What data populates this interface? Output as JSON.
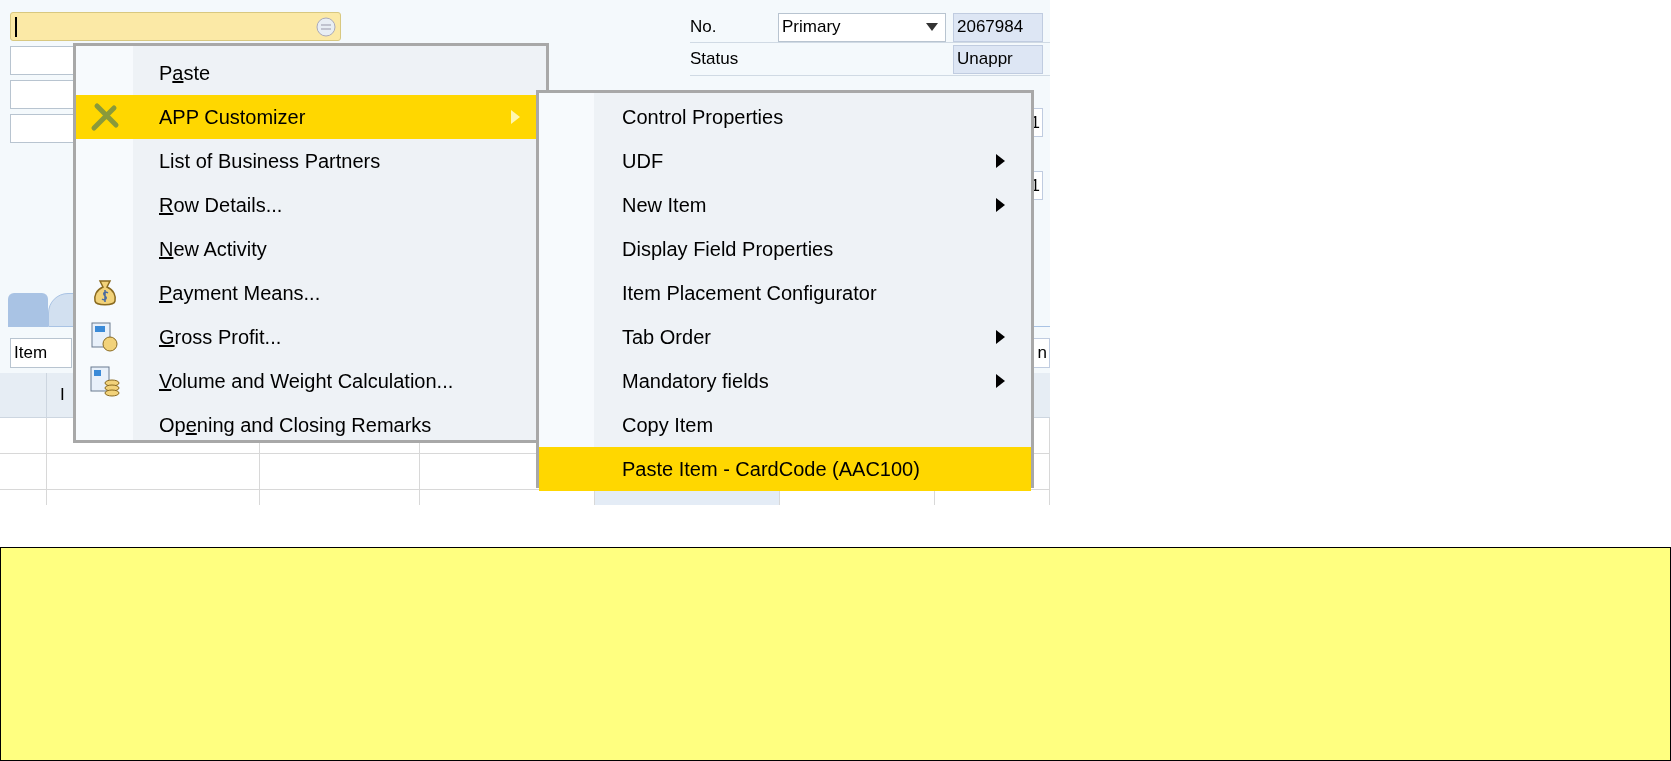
{
  "form": {
    "number_label": "No.",
    "series_dropdown": "Primary",
    "number": "2067984",
    "status_label": "Status",
    "status": "Unappr",
    "partial_values": [
      "1",
      "1"
    ],
    "partial_field": "n"
  },
  "matrix": {
    "type_dropdown": "Item",
    "column_1": "I"
  },
  "context_menu": {
    "items": [
      {
        "text": [
          {
            "part": "P",
            "underlined": false
          },
          {
            "part": "a",
            "underlined": true
          },
          {
            "part": "ste",
            "underlined": false
          }
        ],
        "selected": false,
        "submenu": false
      },
      {
        "text": [
          {
            "part": "APP Customizer",
            "underlined": false
          }
        ],
        "selected": true,
        "submenu": true
      },
      {
        "text": [
          {
            "part": "List of Business Partners",
            "underlined": false
          }
        ],
        "selected": false,
        "submenu": false
      },
      {
        "text": [
          {
            "part": "R",
            "underlined": true
          },
          {
            "part": "ow Details...",
            "underlined": false
          }
        ],
        "selected": false,
        "submenu": false
      },
      {
        "text": [
          {
            "part": "N",
            "underlined": true
          },
          {
            "part": "ew Activity",
            "underlined": false
          }
        ],
        "selected": false,
        "submenu": false
      },
      {
        "text": [
          {
            "part": "P",
            "underlined": true
          },
          {
            "part": "ayment Means...",
            "underlined": false
          }
        ],
        "selected": false,
        "submenu": false
      },
      {
        "text": [
          {
            "part": "G",
            "underlined": true
          },
          {
            "part": "ross Profit...",
            "underlined": false
          }
        ],
        "selected": false,
        "submenu": false
      },
      {
        "text": [
          {
            "part": "V",
            "underlined": true
          },
          {
            "part": "olume and Weight Calculation...",
            "underlined": false
          }
        ],
        "selected": false,
        "submenu": false
      },
      {
        "text": [
          {
            "part": "Op",
            "underlined": false
          },
          {
            "part": "e",
            "underlined": true
          },
          {
            "part": "ning and Closing Remarks",
            "underlined": false
          }
        ],
        "selected": false,
        "submenu": false
      }
    ]
  },
  "submenu": {
    "items": [
      {
        "text": [
          {
            "part": "Control Properties",
            "underlined": false
          }
        ],
        "selected": false,
        "submenu": false
      },
      {
        "text": [
          {
            "part": "UDF",
            "underlined": false
          }
        ],
        "selected": false,
        "submenu": true
      },
      {
        "text": [
          {
            "part": "New Item",
            "underlined": false
          }
        ],
        "selected": false,
        "submenu": true
      },
      {
        "text": [
          {
            "part": "Display Field Properties",
            "underlined": false
          }
        ],
        "selected": false,
        "submenu": false
      },
      {
        "text": [
          {
            "part": "Item Placement Configurator",
            "underlined": false
          }
        ],
        "selected": false,
        "submenu": false
      },
      {
        "text": [
          {
            "part": "Tab Order",
            "underlined": false
          }
        ],
        "selected": false,
        "submenu": true
      },
      {
        "text": [
          {
            "part": "Mandatory fields",
            "underlined": false
          }
        ],
        "selected": false,
        "submenu": true
      },
      {
        "text": [
          {
            "part": "Copy Item",
            "underlined": false
          }
        ],
        "selected": false,
        "submenu": false
      },
      {
        "text": [
          {
            "part": "Paste Item - CardCode (AAC100)",
            "underlined": false
          }
        ],
        "selected": true,
        "submenu": false
      }
    ]
  }
}
